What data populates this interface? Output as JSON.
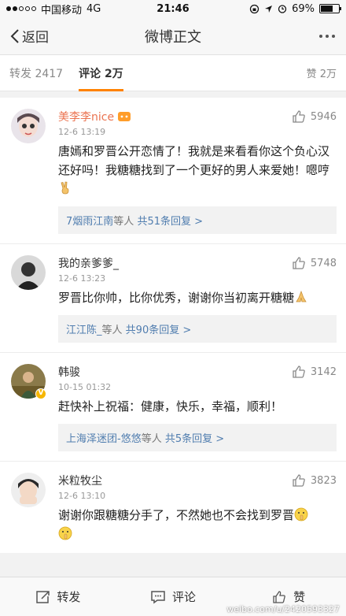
{
  "status_bar": {
    "carrier": "中国移动",
    "network": "4G",
    "time": "21:46",
    "battery": "69%",
    "battery_level": 0.69
  },
  "nav": {
    "back_label": "返回",
    "title": "微博正文"
  },
  "tabs": {
    "repost": "转发 2417",
    "comment": "评论 2万",
    "like": "赞 2万"
  },
  "comments": [
    {
      "name": "美李李nice",
      "time": "12-6 13:19",
      "likes": "5946",
      "text": "唐嫣和罗晋公开恋情了！我就是来看看你这个负心汉还好吗！我糖糖找到了一个更好的男人来爱她！嗯哼",
      "reply_user": "7烟雨江南",
      "reply_suffix": "等人",
      "reply_count": "共51条回复 >"
    },
    {
      "name": "我的亲爹爹_",
      "time": "12-6 13:23",
      "likes": "5748",
      "text": "罗晋比你帅，比你优秀，谢谢你当初离开糖糖",
      "reply_user": "江江陈_",
      "reply_suffix": "等人",
      "reply_count": "共90条回复 >"
    },
    {
      "name": "韩骏",
      "time": "10-15 01:32",
      "likes": "3142",
      "text": "赶快补上祝福：健康，快乐，幸福，顺利！",
      "reply_user": "上海泽迷团-悠悠",
      "reply_suffix": "等人",
      "reply_count": "共5条回复 >"
    },
    {
      "name": "米粒牧尘",
      "time": "12-6 13:10",
      "likes": "3823",
      "text": "谢谢你跟糖糖分手了，不然她也不会找到罗晋"
    }
  ],
  "bottom_bar": {
    "repost": "转发",
    "comment": "评论",
    "like": "赞"
  },
  "watermark": "weibo.com/u/2420593327",
  "colors": {
    "accent": "#ff8200",
    "vip_name": "#eb7350",
    "link": "#507daf"
  }
}
